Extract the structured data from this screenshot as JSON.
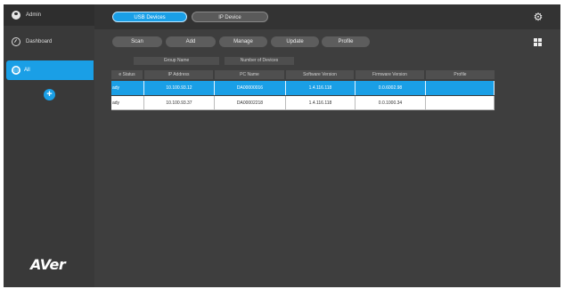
{
  "sidebar": {
    "user_label": "Admin",
    "dashboard_label": "Dashboard",
    "group_label": "All",
    "add_group_symbol": "+",
    "logo_text": "AVer"
  },
  "tabs": [
    {
      "label": "USB Devices",
      "active": true
    },
    {
      "label": "IP Device",
      "active": false
    }
  ],
  "toolbar": {
    "scan": "Scan",
    "add": "Add",
    "manage": "Manage",
    "update": "Update",
    "profile": "Profile"
  },
  "group_info": {
    "group_name_label": "Group Name",
    "device_count_label": "Number of Devices"
  },
  "table": {
    "columns": [
      "e Status",
      "IP Address",
      "PC Name",
      "Software Version",
      "Firmware Version",
      "Profile"
    ],
    "rows": [
      {
        "status": "ady",
        "ip": "10.100.93.12",
        "pc_name": "DA00000016",
        "software": "1.4.116.118",
        "firmware": "0.0.6002.98",
        "profile": "",
        "selected": true
      },
      {
        "status": "ady",
        "ip": "10.100.93.37",
        "pc_name": "DA00002218",
        "software": "1.4.116.118",
        "firmware": "0.0.1000.34",
        "profile": "",
        "selected": false
      }
    ]
  },
  "colors": {
    "accent": "#1a9fe6",
    "sidebar": "#393939",
    "content": "#3e3e3e"
  },
  "icons": [
    "user-icon",
    "dashboard-icon",
    "globe-icon",
    "plus-icon",
    "gear-icon",
    "grid-icon"
  ]
}
